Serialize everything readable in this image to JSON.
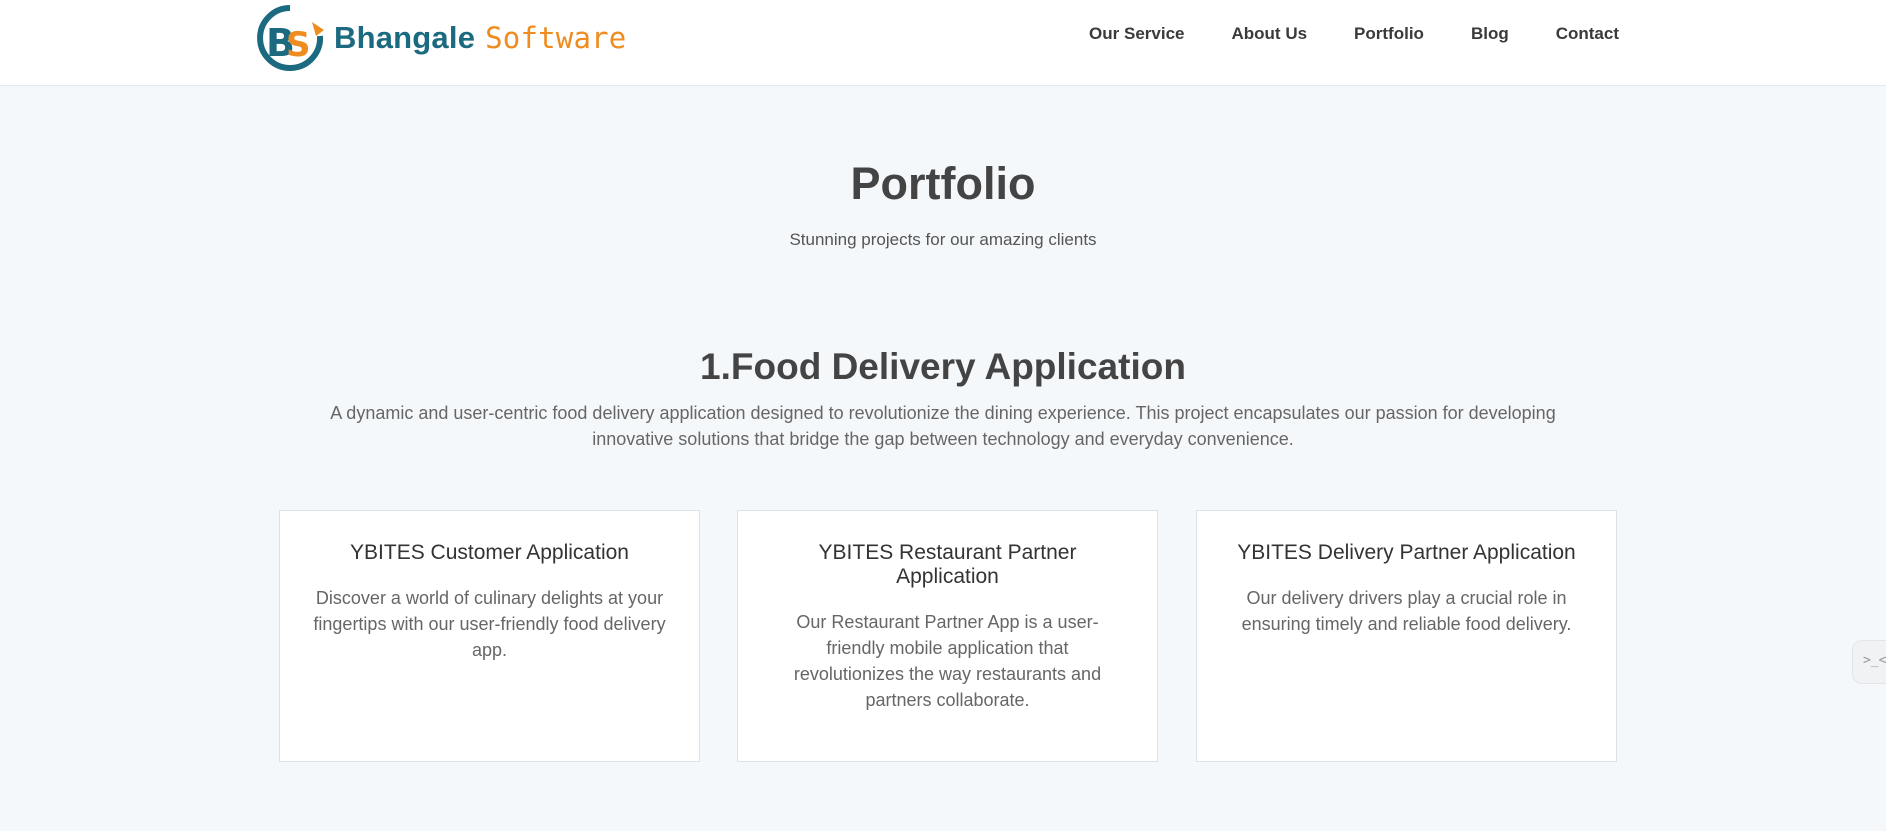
{
  "header": {
    "brand_primary": "Bhangale",
    "brand_secondary": "Software",
    "logo_letters": "BS",
    "nav": [
      {
        "label": "Our Service"
      },
      {
        "label": "About Us"
      },
      {
        "label": "Portfolio"
      },
      {
        "label": "Blog"
      },
      {
        "label": "Contact"
      }
    ]
  },
  "hero": {
    "title": "Portfolio",
    "subtitle": "Stunning projects for our amazing clients"
  },
  "section": {
    "title": "1.Food Delivery Application",
    "description": "A dynamic and user-centric food delivery application designed to revolutionize the dining experience. This project encapsulates our passion for developing innovative solutions that bridge the gap between technology and everyday convenience."
  },
  "cards": [
    {
      "title": "YBITES Customer Application",
      "text": "Discover a world of culinary delights at your fingertips with our user-friendly food delivery app."
    },
    {
      "title": "YBITES Restaurant Partner Application",
      "text": "Our Restaurant Partner App is a user-friendly mobile application that revolutionizes the way restaurants and partners collaborate."
    },
    {
      "title": "YBITES Delivery Partner Application",
      "text": "Our delivery drivers play a crucial role in ensuring timely and reliable food delivery."
    }
  ],
  "side_tab": {
    "glyph": ">_<"
  },
  "colors": {
    "brand_blue": "#1b6a80",
    "brand_orange": "#ef8c1f",
    "page_background": "#f5f8fa"
  }
}
